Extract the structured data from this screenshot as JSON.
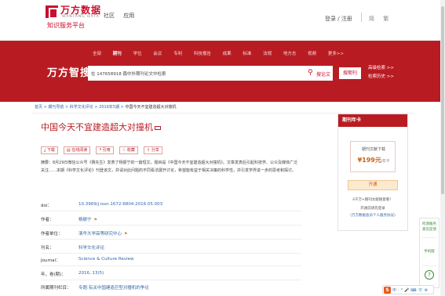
{
  "header": {
    "logo_text": "万方数据",
    "logo_sub": "WANFANG DATA",
    "logo_tag": "知识服务平台",
    "nav": [
      "社区",
      "应用"
    ],
    "login_label": "登录 / 注册",
    "lang": [
      "简",
      "繁"
    ]
  },
  "search": {
    "categories": [
      "全部",
      "期刊",
      "学位",
      "会议",
      "专利",
      "科技报告",
      "成果",
      "标准",
      "法规",
      "地方志",
      "视频",
      "更多>>"
    ],
    "active_category": "期刊",
    "brand": "万方智搜",
    "input_value": "在 147658918 篇中外期刊论文中检索",
    "search_here_label": "搜论文",
    "search_journal_label": "搜期刊",
    "advanced_label": "高级检索 >>",
    "history_label": "检索历史 >>"
  },
  "breadcrumb": {
    "items": [
      "首页",
      "期刊导航",
      "科学文化评论",
      "2016年5期"
    ],
    "current": "中国今天不宜建造超大对撞机"
  },
  "article": {
    "title": "中国今天不宜建造超大对撞机",
    "actions": [
      "下载",
      "在线阅读",
      "引用",
      "收藏",
      "分享"
    ],
    "abstract": "摘要：8月29日微信公众号《赛先生》发表了杨振宁的一篇短文，题目是《中国今天不宜建造超大对撞机》。文章发表后引起科技界、公众及媒体广泛关注……本期《科学文化评论》刊登该文，并请对此问题的不同看法展开讨论，希望能有益于相关决策的科学性，并引发学界进一步的思考和探讨。",
    "fields": [
      {
        "label": "doi：",
        "value": "10.3969/j.issn.1672-6804.2016.05.003"
      },
      {
        "label": "作者：",
        "value": "杨振宁"
      },
      {
        "label": "作者单位：",
        "value": "清华大学高等研究中心"
      },
      {
        "label": "刊名：",
        "value": "科学文化评论"
      },
      {
        "label": "Journal：",
        "value": "Science & Culture Review"
      },
      {
        "label": "年，卷(期)：",
        "value": "2016, 13(5)"
      },
      {
        "label": "所属期刊栏目：",
        "value": "专题:有关中国建造巨型对撞机的争论"
      }
    ]
  },
  "card": {
    "head": "期刊年卡",
    "price_label": "期刊文献下载",
    "price": "¥199元",
    "price_unit": "/年卡",
    "open_label": "开通",
    "note1": "4千万+期刊文献随意看！",
    "note2": "开通前请先登录",
    "note3": "(万方数据会员个人服务协议)"
  },
  "float_tools": [
    "检测服务",
    "意见反馈",
    "手机版"
  ],
  "ime": {
    "logo": "S",
    "items": "中·°🎤⌨👕⚙"
  }
}
